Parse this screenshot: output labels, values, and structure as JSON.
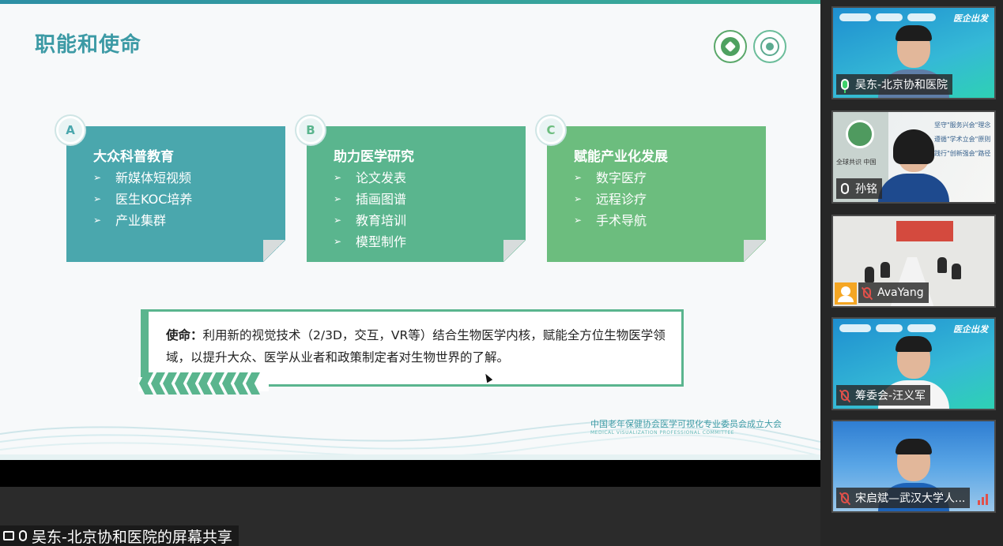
{
  "slide": {
    "title": "职能和使命",
    "cards": [
      {
        "badge": "A",
        "title": "大众科普教育",
        "items": [
          "新媒体短视频",
          "医生KOC培养",
          "产业集群"
        ]
      },
      {
        "badge": "B",
        "title": "助力医学研究",
        "items": [
          "论文发表",
          "插画图谱",
          "教育培训",
          "模型制作"
        ]
      },
      {
        "badge": "C",
        "title": "赋能产业化发展",
        "items": [
          "数字医疗",
          "远程诊疗",
          "手术导航"
        ]
      }
    ],
    "mission_label": "使命：",
    "mission_text": "利用新的视觉技术（2/3D，交互，VR等）结合生物医学内核，赋能全方位生物医学领域，以提升大众、医学从业者和政策制定者对生物世界的了解。",
    "footer_cn": "中国老年保健协会医学可视化专业委员会成立大会",
    "footer_en": "MEDICAL VISUALIZATION PROFESSIONAL COMMITTEE",
    "arrow_glyph": "➢"
  },
  "share": {
    "label": "吴东-北京协和医院的屏幕共享"
  },
  "participants": [
    {
      "name": "吴东-北京协和医院",
      "mic": "active",
      "banner_slogan": "医企出发"
    },
    {
      "name": "孙铭",
      "mic": "on"
    },
    {
      "name": "AvaYang",
      "mic": "muted"
    },
    {
      "name": "筹委会-汪义军",
      "mic": "muted",
      "banner_slogan": "医企出发"
    },
    {
      "name": "宋启斌—武汉大学人...",
      "mic": "muted"
    }
  ],
  "tile2_slogans": [
    "坚守\"服务兴会\"理念",
    "遵循\"学术立会\"原则",
    "践行\"创新强会\"路径"
  ],
  "tile2_banner": [
    "全球共识 中国"
  ],
  "colors": {
    "teal": "#4aa7ad",
    "green": "#5ab58e",
    "light_green": "#6cbd7e",
    "title": "#3c9aa5",
    "active_mic": "#3fd16b",
    "muted_mic": "#e0504a"
  }
}
